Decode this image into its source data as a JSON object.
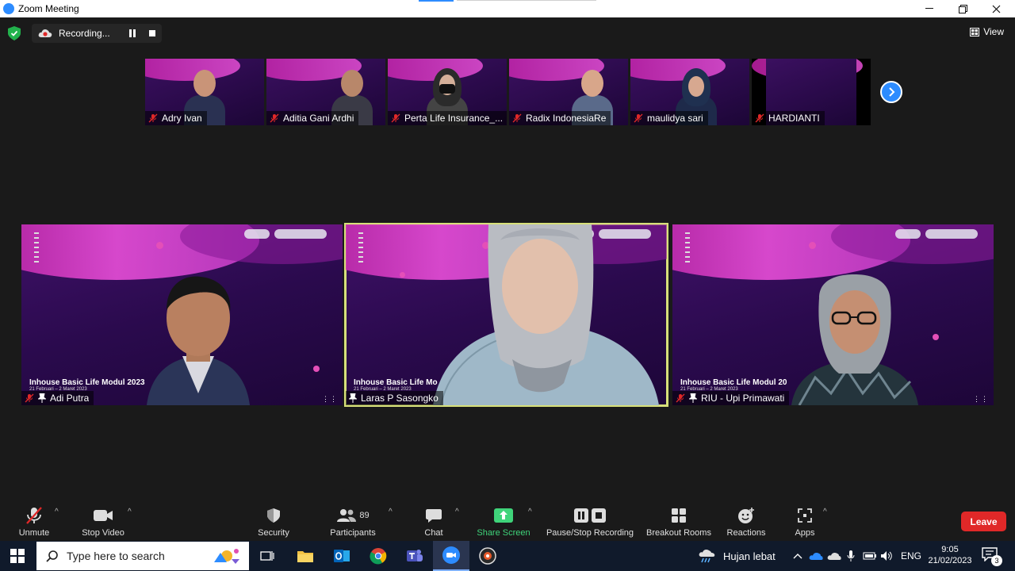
{
  "window": {
    "title": "Zoom Meeting"
  },
  "recording": {
    "label": "Recording..."
  },
  "view": {
    "label": "View"
  },
  "thumbnails": [
    {
      "name": "Adry Ivan",
      "type": "man",
      "skin": "#c99478",
      "shirt": "#2a3152"
    },
    {
      "name": "Aditia Gani Ardhi",
      "type": "man",
      "skin": "#b8876a",
      "shirt": "#3a3a46"
    },
    {
      "name": "Perta Life Insurance_...",
      "type": "hijab-mask",
      "skin": "#d5b09a",
      "shirt": "#444"
    },
    {
      "name": "Radix IndonesiaRe",
      "type": "man",
      "skin": "#d8a68a",
      "shirt": "#5a6a8a"
    },
    {
      "name": "maulidya sari",
      "type": "hijab",
      "skin": "#d7a890",
      "shirt": "#1e2a4a"
    },
    {
      "name": "HARDIANTI",
      "type": "none",
      "skin": "#000",
      "shirt": "#000"
    }
  ],
  "tiles": [
    {
      "name": "Adi Putra",
      "caption": "Inhouse Basic Life Modul 2023",
      "subcaption": "21 Februari – 2 Maret 2023"
    },
    {
      "name": "Laras P Sasongko",
      "caption": "Inhouse Basic Life Mo",
      "subcaption": "21 Februari – 2 Maret 2023"
    },
    {
      "name": "RIU - Upi Primawati",
      "caption": "Inhouse Basic Life Modul 20",
      "subcaption": "21 Februari – 2 Maret 2023"
    }
  ],
  "toolbar": {
    "unmute": "Unmute",
    "stop_video": "Stop Video",
    "security": "Security",
    "participants": "Participants",
    "participants_count": "89",
    "chat": "Chat",
    "share_screen": "Share Screen",
    "pause_recording": "Pause/Stop Recording",
    "breakout_rooms": "Breakout Rooms",
    "reactions": "Reactions",
    "apps": "Apps",
    "leave": "Leave"
  },
  "taskbar": {
    "search_placeholder": "Type here to search",
    "weather": "Hujan lebat",
    "language": "ENG",
    "time": "9:05",
    "date": "21/02/2023",
    "notifications": "3"
  },
  "colors": {
    "zoom_blue": "#2d8cff",
    "share_green": "#3fd47a",
    "leave_red": "#e02828",
    "active_speaker_border": "#d7e07a",
    "background_purple": "#2a0a4d",
    "background_magenta": "#e84ed8"
  }
}
